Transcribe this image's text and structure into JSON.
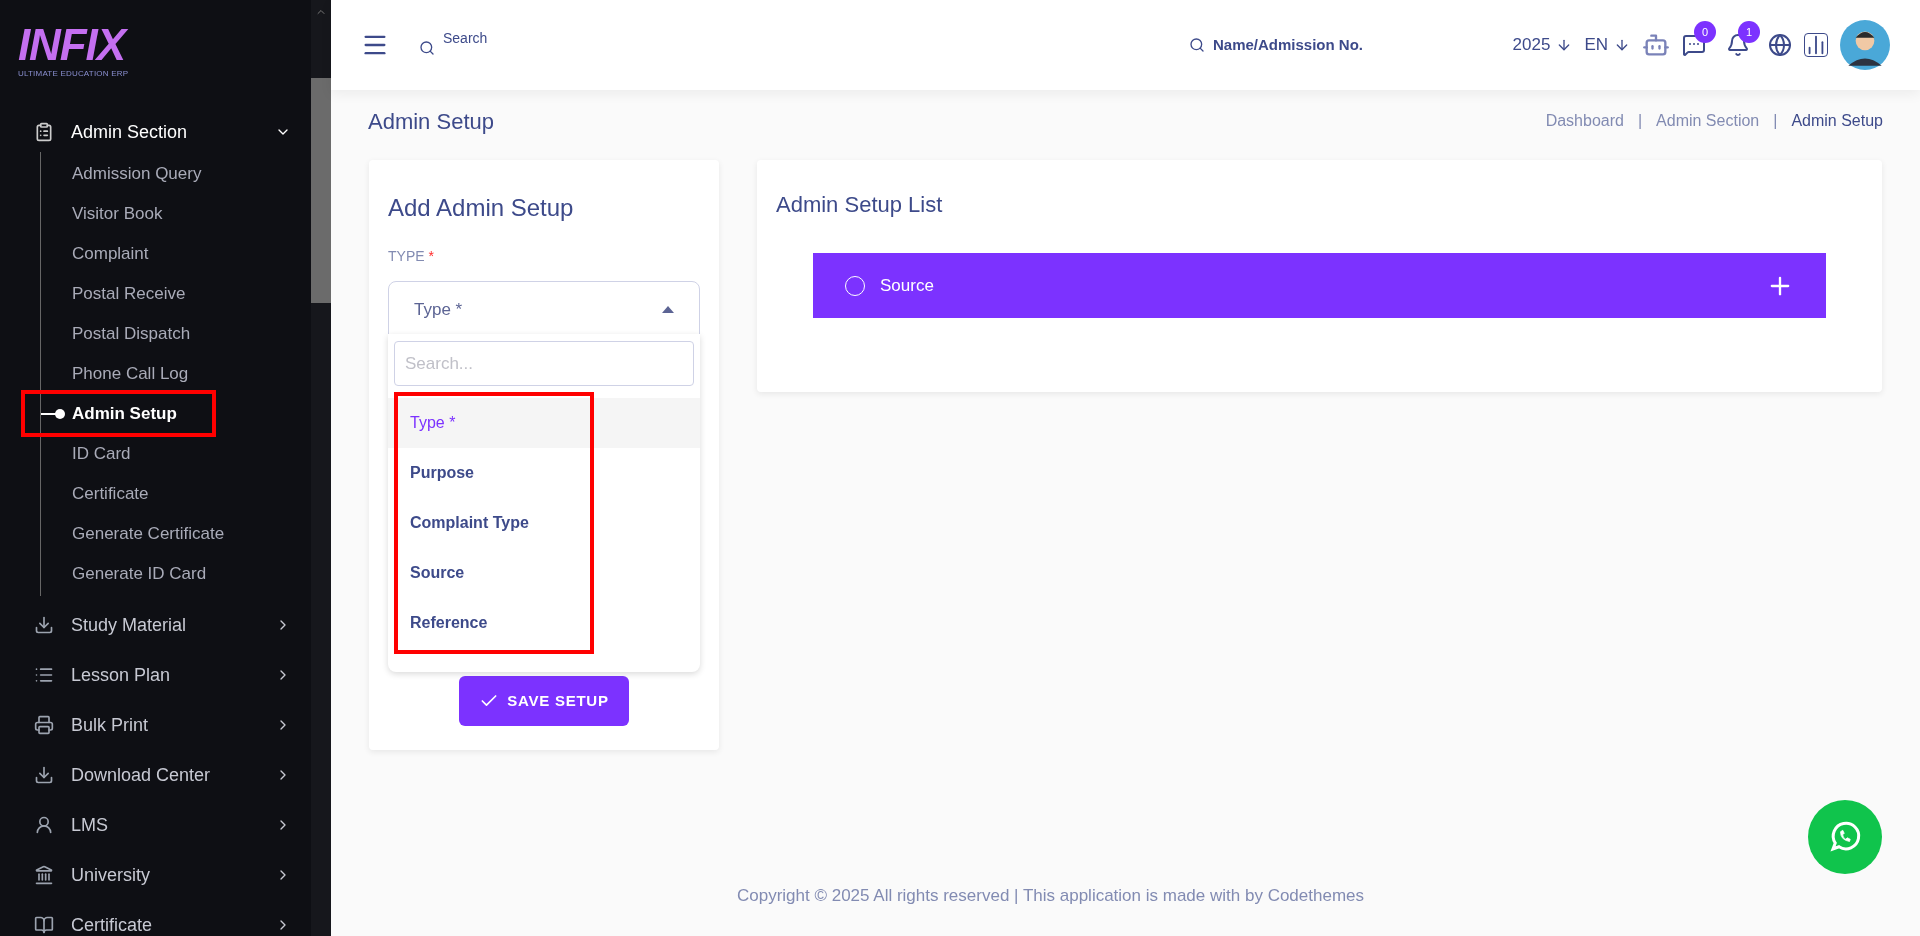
{
  "logo": {
    "text": "INFIX",
    "tagline": "ULTIMATE EDUCATION ERP"
  },
  "sidebar": {
    "section": {
      "label": "Admin Section",
      "expanded": true,
      "children": [
        {
          "label": "Admission Query",
          "selected": false
        },
        {
          "label": "Visitor Book",
          "selected": false
        },
        {
          "label": "Complaint",
          "selected": false
        },
        {
          "label": "Postal Receive",
          "selected": false
        },
        {
          "label": "Postal Dispatch",
          "selected": false
        },
        {
          "label": "Phone Call Log",
          "selected": false
        },
        {
          "label": "Admin Setup",
          "selected": true
        },
        {
          "label": "ID Card",
          "selected": false
        },
        {
          "label": "Certificate",
          "selected": false
        },
        {
          "label": "Generate Certificate",
          "selected": false
        },
        {
          "label": "Generate ID Card",
          "selected": false
        }
      ]
    },
    "items": [
      {
        "label": "Study Material",
        "kind": "download"
      },
      {
        "label": "Lesson Plan",
        "kind": "list"
      },
      {
        "label": "Bulk Print",
        "kind": "print"
      },
      {
        "label": "Download Center",
        "kind": "download"
      },
      {
        "label": "LMS",
        "kind": "person"
      },
      {
        "label": "University",
        "kind": "bank"
      },
      {
        "label": "Certificate",
        "kind": "book"
      }
    ]
  },
  "header": {
    "search_placeholder": "Search",
    "student_search_placeholder": "Name/Admission No.",
    "year": "2025",
    "language": "EN",
    "messages_count": "0",
    "notifications_count": "1"
  },
  "page_title": "Admin Setup",
  "breadcrumb": [
    "Dashboard",
    "Admin Section",
    "Admin Setup"
  ],
  "breadcrumb_separator": "|",
  "form": {
    "title": "Add Admin Setup",
    "type_label": "TYPE",
    "required_mark": "*",
    "select_value": "Type *",
    "dropdown_search_placeholder": "Search...",
    "options": [
      {
        "label": "Type *",
        "selected": true
      },
      {
        "label": "Purpose",
        "selected": false
      },
      {
        "label": "Complaint Type",
        "selected": false
      },
      {
        "label": "Source",
        "selected": false
      },
      {
        "label": "Reference",
        "selected": false
      }
    ],
    "save_button": "SAVE SETUP"
  },
  "list": {
    "title": "Admin Setup List",
    "groups": [
      {
        "label": "Source",
        "expanded": false
      }
    ]
  },
  "footer": "Copyright © 2025 All rights reserved | This application is made with by Codethemes"
}
